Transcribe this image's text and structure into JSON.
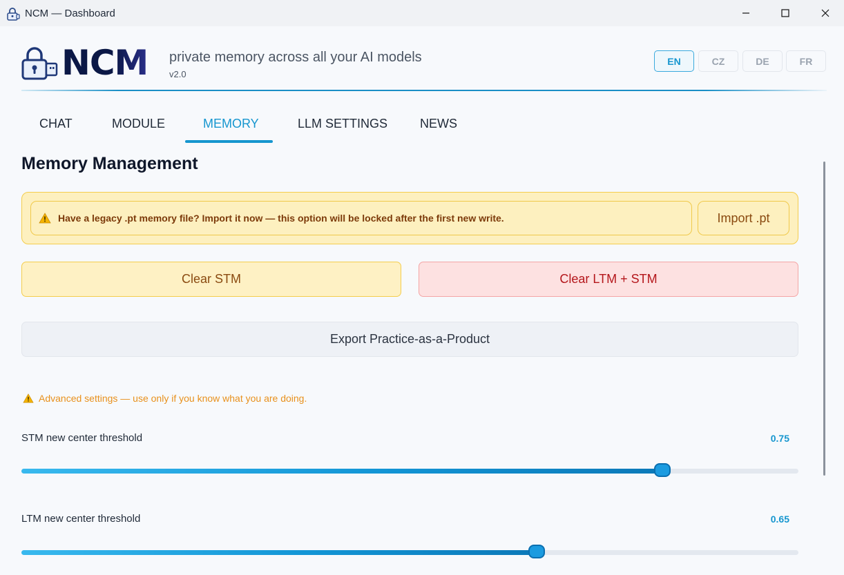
{
  "window": {
    "title": "NCM — Dashboard",
    "controls": [
      "minimize",
      "maximize",
      "close"
    ]
  },
  "header": {
    "logo_text": "NCM",
    "tagline": "private memory across all your AI models",
    "version": "v2.0",
    "languages": [
      {
        "code": "EN",
        "active": true
      },
      {
        "code": "CZ",
        "active": false
      },
      {
        "code": "DE",
        "active": false
      },
      {
        "code": "FR",
        "active": false
      }
    ]
  },
  "tabs": [
    {
      "label": "CHAT",
      "active": false
    },
    {
      "label": "MODULE",
      "active": false
    },
    {
      "label": "MEMORY",
      "active": true
    },
    {
      "label": "LLM SETTINGS",
      "active": false
    },
    {
      "label": "NEWS",
      "active": false
    }
  ],
  "memory": {
    "title": "Memory Management",
    "legacy_notice": "Have a legacy .pt memory file? Import it now — this option will be locked after the first new write.",
    "import_label": "Import .pt",
    "clear_stm_label": "Clear STM",
    "clear_ltm_label": "Clear LTM + STM",
    "export_label": "Export Practice-as-a-Product",
    "advanced_warning": "Advanced settings — use only if you know what you are doing.",
    "sliders": [
      {
        "label": "STM new center threshold",
        "value": "0.75",
        "fraction": 0.825
      },
      {
        "label": "LTM new center threshold",
        "value": "0.65",
        "fraction": 0.663
      }
    ]
  },
  "colors": {
    "accent": "#1696cf",
    "warning_bg": "#fdf0bf",
    "danger_bg": "#fde1e1",
    "advanced_warning": "#e8901b"
  },
  "icons": {
    "app": "lock-usb-icon",
    "warning": "warning-triangle-icon"
  }
}
